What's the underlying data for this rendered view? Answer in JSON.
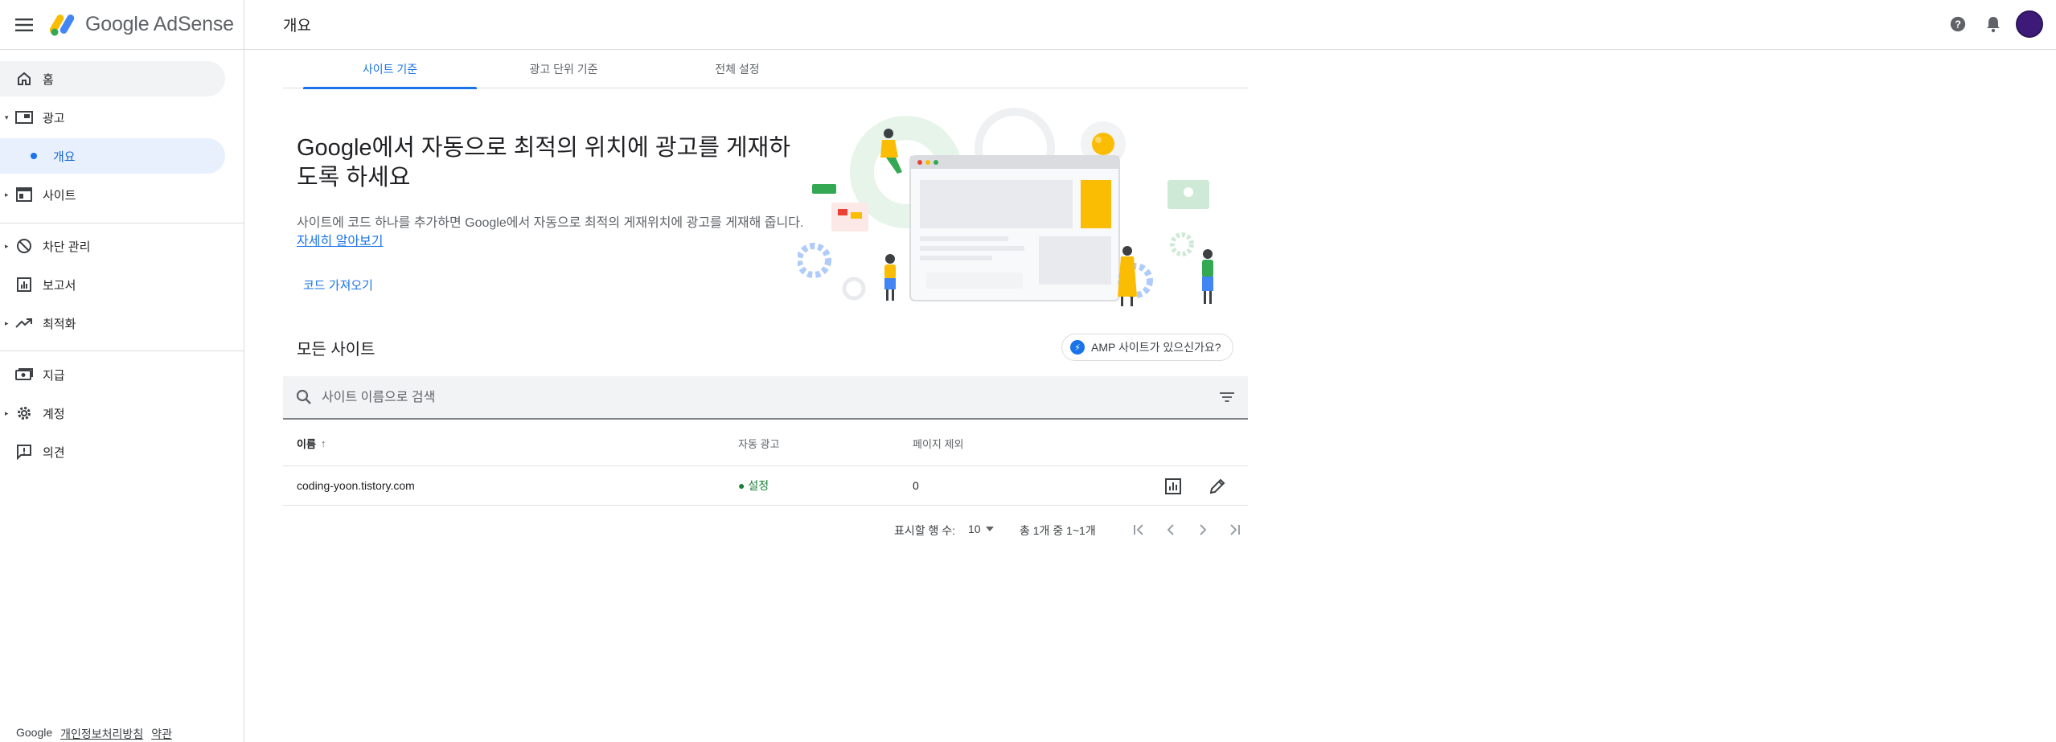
{
  "header": {
    "brand_name": "Google AdSense",
    "page_title": "개요"
  },
  "sidebar": {
    "items": [
      {
        "label": "홈"
      },
      {
        "label": "광고"
      },
      {
        "label": "개요"
      },
      {
        "label": "사이트"
      },
      {
        "label": "차단 관리"
      },
      {
        "label": "보고서"
      },
      {
        "label": "최적화"
      },
      {
        "label": "지급"
      },
      {
        "label": "계정"
      },
      {
        "label": "의견"
      }
    ],
    "footer": {
      "brand": "Google",
      "privacy": "개인정보처리방침",
      "terms": "약관"
    }
  },
  "tabs": [
    {
      "label": "사이트 기준",
      "active": true
    },
    {
      "label": "광고 단위 기준",
      "active": false
    },
    {
      "label": "전체 설정",
      "active": false
    }
  ],
  "hero": {
    "title": "Google에서 자동으로 최적의 위치에 광고를 게재하도록 하세요",
    "description": "사이트에 코드 하나를 추가하면 Google에서 자동으로 최적의 게재위치에 광고를 게재해 줍니다.",
    "learn_more": "자세히 알아보기",
    "get_code": "코드 가져오기"
  },
  "sites_section": {
    "title": "모든 사이트",
    "amp_button": "AMP 사이트가 있으신가요?",
    "search_placeholder": "사이트 이름으로 검색"
  },
  "table": {
    "columns": [
      "이름",
      "자동 광고",
      "페이지 제외"
    ],
    "sort_indicator": "↑",
    "rows": [
      {
        "name": "coding-yoon.tistory.com",
        "auto_ads": "● 설정",
        "excluded_pages": "0"
      }
    ]
  },
  "pagination": {
    "rows_per_page_label": "표시할 행 수:",
    "rows_per_page": "10",
    "range": "총 1개 중 1~1개"
  },
  "colors": {
    "accent": "#1a73e8",
    "status_on": "#188038",
    "nav_selected_bg": "#e8f0fe",
    "avatar": "#3d1a78"
  }
}
